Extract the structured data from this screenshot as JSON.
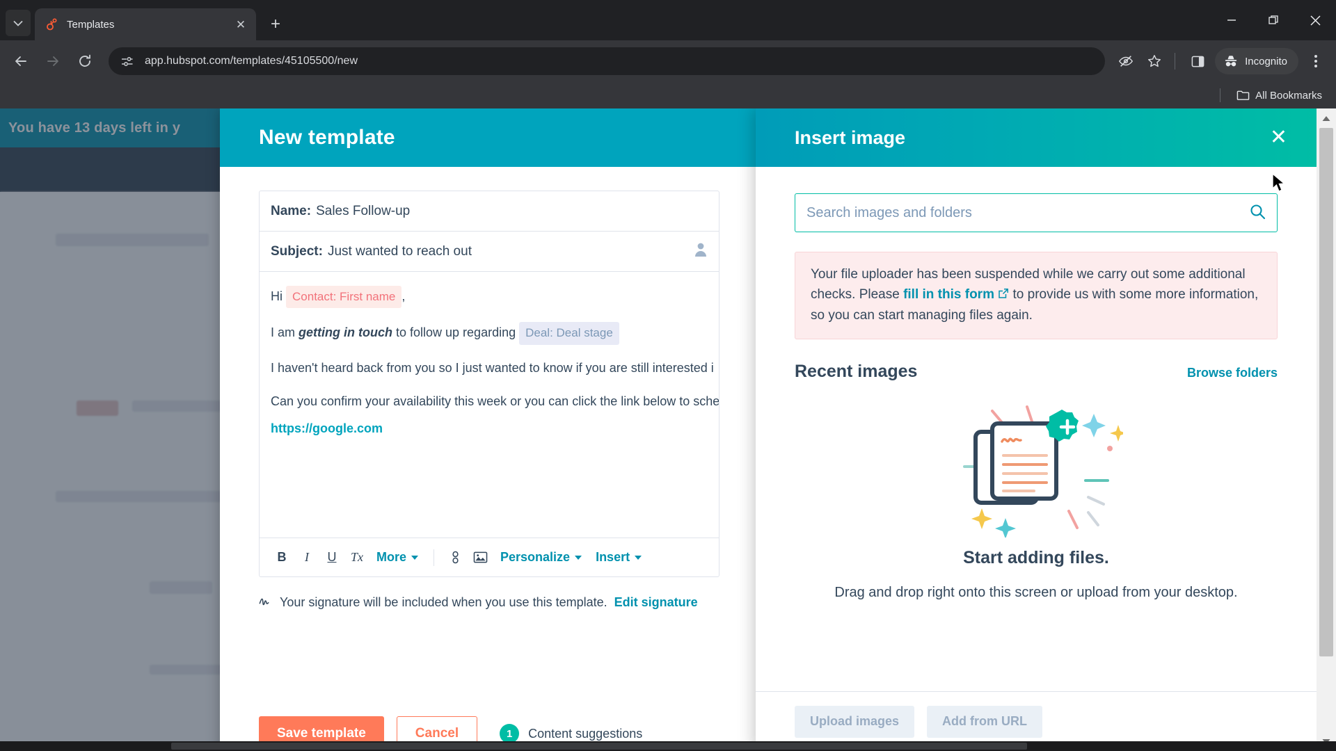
{
  "browser": {
    "tab": {
      "title": "Templates",
      "favicon": "hubspot-sprocket-icon",
      "close_label": "✕"
    },
    "newtab_label": "+",
    "window_controls": {
      "minimize": "minimize-icon",
      "maximize": "maximize-icon",
      "close": "close-icon"
    },
    "nav": {
      "back": "back-arrow-icon",
      "forward": "forward-arrow-icon",
      "reload": "reload-icon"
    },
    "omnibox": {
      "url": "app.hubspot.com/templates/45105500/new",
      "site_icon": "page-settings-icon"
    },
    "actions": {
      "tracking_protection": "eye-off-icon",
      "bookmark": "star-icon",
      "side_panel": "side-panel-icon",
      "profile_label": "Incognito",
      "menu": "kebab-menu-icon"
    },
    "bookmarks_bar": {
      "all_bookmarks_label": "All Bookmarks",
      "folder_icon": "folder-icon"
    }
  },
  "background_app": {
    "trial_banner": "You have 13 days left in y"
  },
  "template_modal": {
    "title": "New template",
    "fields": [
      {
        "label": "Name:",
        "value": "Sales Follow-up"
      },
      {
        "label": "Subject:",
        "value": "Just wanted to reach out",
        "trailing_icon": "person-icon"
      }
    ],
    "body": {
      "greeting_prefix": "Hi",
      "token_contact": "Contact: First name",
      "greeting_suffix": ",",
      "line2_a": "I am ",
      "line2_bold": "getting in touch",
      "line2_b": " to follow up regarding ",
      "token_deal": "Deal: Deal stage",
      "line3": "I haven't heard back from you so I just wanted to know if you are still interested i",
      "line4": "Can you confirm your availability this week or you can click the link below to sche",
      "link": "https://google.com"
    },
    "toolbar": {
      "bold": "B",
      "italic": "I",
      "underline": "U",
      "clear_format": "Tx",
      "more_label": "More",
      "link_icon": "link-icon",
      "image_icon": "image-icon",
      "personalize_label": "Personalize",
      "insert_label": "Insert"
    },
    "signature_note": {
      "icon": "signature-icon",
      "text": "Your signature will be included when you use this template.",
      "link": "Edit signature"
    },
    "footer": {
      "save_label": "Save template",
      "cancel_label": "Cancel",
      "suggestions_count": "1",
      "suggestions_label": "Content suggestions"
    },
    "colors": {
      "header": "#00a4bd",
      "primary_button": "#ff7a59",
      "badge": "#00bda5"
    }
  },
  "insert_image_panel": {
    "title": "Insert image",
    "close_label": "✕",
    "search": {
      "placeholder": "Search images and folders",
      "value": "",
      "icon": "search-icon"
    },
    "warning": {
      "text_before": "Your file uploader has been suspended while we carry out some additional checks. Please ",
      "link": "fill in this form",
      "link_icon": "external-link-icon",
      "text_after": " to provide us with some more information, so you can start managing files again."
    },
    "recent": {
      "heading": "Recent images",
      "browse_label": "Browse folders"
    },
    "empty_state": {
      "illustration": "documents-with-plus-badge-illustration",
      "title": "Start adding files.",
      "subtitle": "Drag and drop right onto this screen or upload from your desktop."
    },
    "footer": {
      "upload_label": "Upload images",
      "add_url_label": "Add from URL"
    },
    "colors": {
      "gradient_start": "#009cb8",
      "gradient_end": "#00bda5",
      "warning_bg": "#fdeced",
      "link": "#0091ae"
    }
  }
}
